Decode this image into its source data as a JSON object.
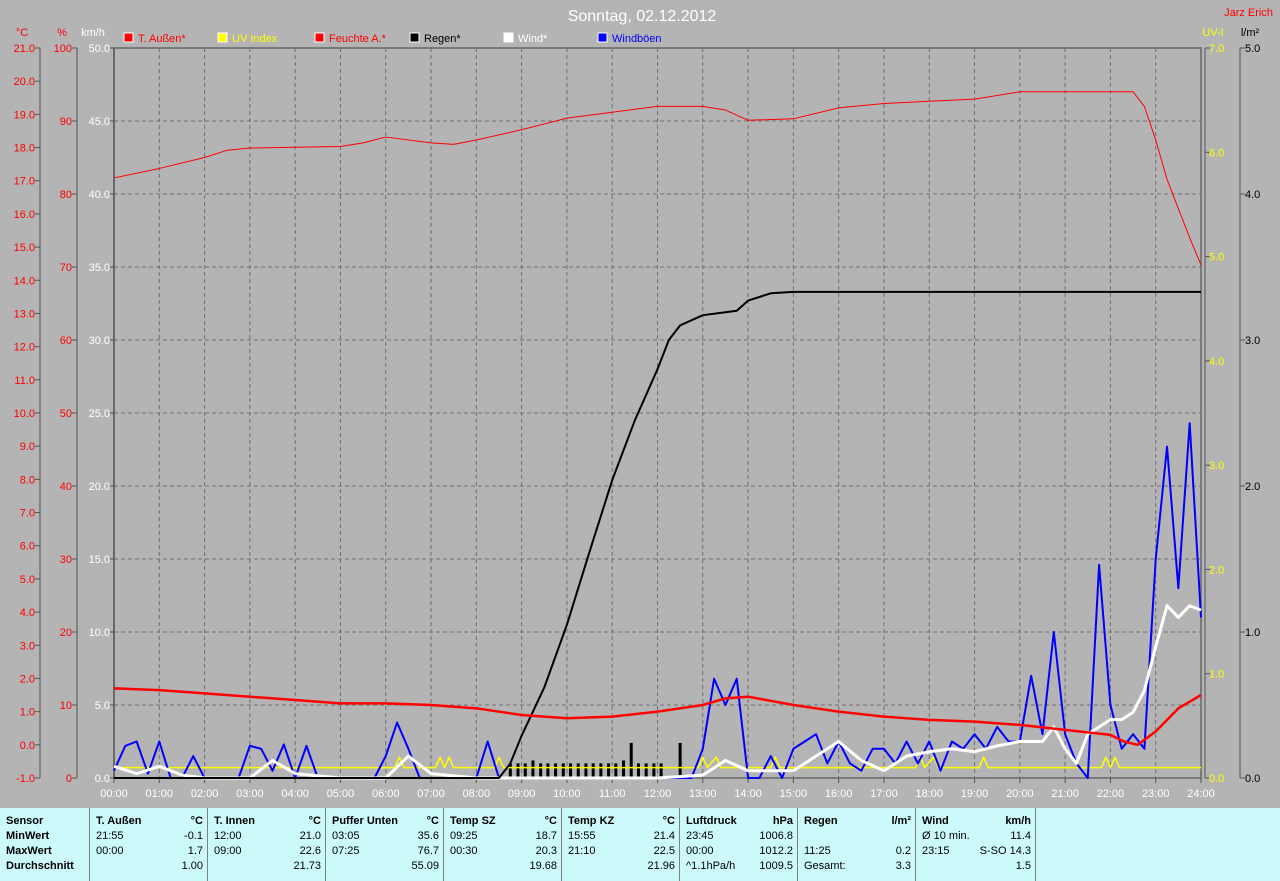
{
  "chart_data": {
    "type": "line",
    "title": "Sonntag, 02.12.2012",
    "author": "Jarz Erich",
    "legend": [
      {
        "label": "T. Außen*",
        "color": "#ff0000"
      },
      {
        "label": "UV Index",
        "color": "#ffff00"
      },
      {
        "label": "Feuchte A.*",
        "color": "#ff0000"
      },
      {
        "label": "Regen*",
        "color": "#000000"
      },
      {
        "label": "Wind*",
        "color": "#ffffff"
      },
      {
        "label": "Windböen",
        "color": "#0000ff"
      }
    ],
    "axes": {
      "temp": {
        "unit": "°C",
        "range": [
          -1,
          21
        ],
        "step": 1,
        "color": "#ff0000"
      },
      "humidity": {
        "unit": "%",
        "range": [
          0,
          100
        ],
        "step": 10,
        "color": "#ff0000"
      },
      "wind": {
        "unit": "km/h",
        "range": [
          0,
          50
        ],
        "step": 5,
        "color": "#ffffff"
      },
      "uv": {
        "unit": "UV-I",
        "range": [
          0,
          7
        ],
        "step": 1,
        "color": "#ffff00"
      },
      "rain": {
        "unit": "l/m²",
        "range": [
          0,
          5
        ],
        "step": 1,
        "color": "#000000"
      },
      "x": {
        "range": [
          0,
          24
        ],
        "ticks": [
          "00:00",
          "01:00",
          "02:00",
          "03:00",
          "04:00",
          "05:00",
          "06:00",
          "07:00",
          "08:00",
          "09:00",
          "10:00",
          "11:00",
          "12:00",
          "13:00",
          "14:00",
          "15:00",
          "16:00",
          "17:00",
          "18:00",
          "19:00",
          "20:00",
          "21:00",
          "22:00",
          "23:00",
          "24:00"
        ]
      }
    },
    "grid": true,
    "series": {
      "humidity": {
        "x": [
          0,
          1,
          2,
          2.5,
          3,
          4,
          5,
          5.5,
          6,
          7,
          7.5,
          8,
          9,
          10,
          11,
          12,
          13,
          13.5,
          14,
          15,
          16,
          17,
          18,
          19,
          20,
          21,
          22,
          22.5,
          22.75,
          23,
          23.25,
          23.5,
          23.75,
          24
        ],
        "y": [
          82.2,
          83.5,
          85,
          86,
          86.3,
          86.4,
          86.5,
          87,
          87.8,
          87,
          86.8,
          87.4,
          88.8,
          90.4,
          91.2,
          92,
          92,
          91.5,
          90.1,
          90.3,
          91.8,
          92.4,
          92.7,
          93,
          94,
          94,
          94,
          94,
          92,
          87.4,
          82,
          78,
          74,
          70.3
        ]
      },
      "temp": {
        "x": [
          0,
          1,
          2,
          3,
          4,
          5,
          6,
          7,
          8,
          9,
          10,
          11,
          12,
          13,
          13.5,
          14,
          15,
          16,
          17,
          18,
          19,
          20,
          21,
          22,
          22.3,
          22.6,
          23,
          23.5,
          24
        ],
        "y": [
          1.7,
          1.65,
          1.55,
          1.45,
          1.35,
          1.25,
          1.25,
          1.2,
          1.1,
          0.9,
          0.8,
          0.85,
          1.0,
          1.2,
          1.4,
          1.45,
          1.2,
          1.0,
          0.85,
          0.75,
          0.7,
          0.6,
          0.45,
          0.3,
          0.1,
          0.0,
          0.4,
          1.1,
          1.5
        ]
      },
      "rain_total": {
        "x": [
          0,
          8.5,
          8.75,
          9,
          9.5,
          10,
          10.5,
          11,
          11.5,
          12,
          12.25,
          12.5,
          13,
          13.5,
          13.75,
          14,
          14.5,
          15,
          24
        ],
        "y": [
          0,
          0,
          0.1,
          0.29,
          0.62,
          1.05,
          1.55,
          2.04,
          2.45,
          2.8,
          3.0,
          3.1,
          3.17,
          3.19,
          3.2,
          3.27,
          3.32,
          3.33,
          3.33
        ]
      },
      "rain_interval": {
        "x": [
          8.75,
          8.92,
          9.08,
          9.25,
          9.42,
          9.58,
          9.75,
          9.92,
          10.08,
          10.25,
          10.42,
          10.58,
          10.75,
          10.92,
          11.08,
          11.25,
          11.42,
          11.58,
          11.75,
          11.92,
          12.08,
          12.5
        ],
        "y": [
          0.1,
          0.1,
          0.1,
          0.12,
          0.1,
          0.1,
          0.1,
          0.1,
          0.1,
          0.1,
          0.1,
          0.1,
          0.1,
          0.1,
          0.1,
          0.12,
          0.24,
          0.1,
          0.1,
          0.1,
          0.1,
          0.24
        ]
      },
      "uv": {
        "x": [
          0,
          6.2,
          6.3,
          6.4,
          7.1,
          7.2,
          7.3,
          7.4,
          7.5,
          8.4,
          8.5,
          8.6,
          12.9,
          13.0,
          13.1,
          13.3,
          13.4,
          13.5,
          14.5,
          14.6,
          14.7,
          17.7,
          17.8,
          17.9,
          18.1,
          18.2,
          18.3,
          19.1,
          19.2,
          19.3,
          21.8,
          21.9,
          22.0,
          22.1,
          22.2,
          22.3,
          24
        ],
        "y": [
          0.1,
          0.1,
          0.2,
          0.1,
          0.1,
          0.2,
          0.1,
          0.2,
          0.1,
          0.1,
          0.2,
          0.1,
          0.1,
          0.2,
          0.1,
          0.2,
          0.1,
          0.1,
          0.1,
          0.2,
          0.1,
          0.1,
          0.2,
          0.1,
          0.2,
          0.1,
          0.1,
          0.1,
          0.2,
          0.1,
          0.1,
          0.2,
          0.1,
          0.2,
          0.1,
          0.1,
          0.1
        ]
      },
      "wind": {
        "x": [
          0,
          0.5,
          1,
          1.5,
          2,
          3,
          3.5,
          4,
          5,
          6,
          6.5,
          7,
          8,
          9,
          12,
          13,
          13.5,
          14,
          15,
          15.5,
          16,
          16.5,
          17,
          17.5,
          18,
          18.5,
          19,
          19.5,
          20,
          20.5,
          20.75,
          21,
          21.25,
          21.5,
          22,
          22.25,
          22.5,
          22.75,
          23,
          23.25,
          23.5,
          23.75,
          24
        ],
        "y": [
          0.8,
          0.3,
          0.8,
          0.2,
          0,
          0,
          1.2,
          0.3,
          0,
          0,
          1.5,
          0.3,
          0,
          0,
          0,
          0.2,
          1.2,
          0.5,
          0.5,
          1.5,
          2.5,
          1.2,
          0.5,
          1.5,
          1.8,
          2,
          1.8,
          2.2,
          2.5,
          2.5,
          3.5,
          2,
          1,
          3,
          4,
          4,
          4.5,
          6,
          9,
          11.8,
          11,
          11.8,
          11.5
        ]
      },
      "gusts": {
        "x": [
          0,
          0.25,
          0.5,
          0.75,
          1,
          1.25,
          1.5,
          1.75,
          2,
          2.75,
          3,
          3.25,
          3.5,
          3.75,
          4,
          4.25,
          4.5,
          5.75,
          6,
          6.25,
          6.5,
          6.75,
          8,
          8.25,
          8.5,
          12.75,
          13,
          13.25,
          13.5,
          13.75,
          14,
          14.25,
          14.5,
          14.75,
          15,
          15.25,
          15.5,
          15.75,
          16,
          16.25,
          16.5,
          16.75,
          17,
          17.25,
          17.5,
          17.75,
          18,
          18.25,
          18.5,
          18.75,
          19,
          19.25,
          19.5,
          19.75,
          20,
          20.25,
          20.5,
          20.75,
          21,
          21.25,
          21.5,
          21.75,
          22,
          22.25,
          22.5,
          22.75,
          23,
          23.25,
          23.5,
          23.75,
          24
        ],
        "y": [
          0.5,
          2.2,
          2.5,
          0.3,
          2.5,
          0,
          0,
          1.5,
          0,
          0,
          2.2,
          2,
          0.5,
          2.3,
          0,
          2.2,
          0,
          0,
          1.5,
          3.8,
          2,
          0,
          0,
          2.5,
          0,
          0,
          2,
          6.8,
          5,
          6.8,
          0,
          0,
          1.5,
          0,
          2,
          2.5,
          3,
          1,
          2.5,
          1,
          0.5,
          2,
          2,
          1,
          2.5,
          1,
          2.5,
          0.5,
          2.5,
          2,
          3,
          2,
          3.5,
          2.5,
          2.5,
          7,
          3,
          10,
          3,
          1,
          0,
          14.6,
          5,
          2,
          3,
          2,
          15,
          22.7,
          13,
          24.3,
          11
        ]
      }
    }
  },
  "table": {
    "columns": [
      {
        "header": [
          "Sensor",
          ""
        ],
        "rows": [
          [
            "MinWert",
            ""
          ],
          [
            "MaxWert",
            ""
          ],
          [
            "Durchschnitt",
            ""
          ]
        ],
        "bold": true
      },
      {
        "header": [
          "T. Außen",
          "°C"
        ],
        "rows": [
          [
            "21:55",
            "-0.1"
          ],
          [
            "00:00",
            "1.7"
          ],
          [
            "",
            "1.00"
          ]
        ]
      },
      {
        "header": [
          "T. Innen",
          "°C"
        ],
        "rows": [
          [
            "12:00",
            "21.0"
          ],
          [
            "09:00",
            "22.6"
          ],
          [
            "",
            "21.73"
          ]
        ]
      },
      {
        "header": [
          "Puffer Unten",
          "°C"
        ],
        "rows": [
          [
            "03:05",
            "35.6"
          ],
          [
            "07:25",
            "76.7"
          ],
          [
            "",
            "55.09"
          ]
        ]
      },
      {
        "header": [
          "Temp SZ",
          "°C"
        ],
        "rows": [
          [
            "09:25",
            "18.7"
          ],
          [
            "00:30",
            "20.3"
          ],
          [
            "",
            "19.68"
          ]
        ]
      },
      {
        "header": [
          "Temp KZ",
          "°C"
        ],
        "rows": [
          [
            "15:55",
            "21.4"
          ],
          [
            "21:10",
            "22.5"
          ],
          [
            "",
            "21.96"
          ]
        ]
      },
      {
        "header": [
          "Luftdruck",
          "hPa"
        ],
        "rows": [
          [
            "23:45",
            "1006.8"
          ],
          [
            "00:00",
            "1012.2"
          ],
          [
            "^1.1hPa/h",
            "1009.5"
          ]
        ]
      },
      {
        "header": [
          "Regen",
          "l/m²"
        ],
        "rows": [
          [
            "",
            ""
          ],
          [
            "11:25",
            "0.2"
          ],
          [
            "Gesamt:",
            "3.3"
          ]
        ]
      },
      {
        "header": [
          "Wind",
          "km/h"
        ],
        "rows": [
          [
            "Ø 10 min.",
            "11.4"
          ],
          [
            "23:15",
            "S-SO 14.3"
          ],
          [
            "",
            "1.5"
          ]
        ]
      }
    ]
  }
}
